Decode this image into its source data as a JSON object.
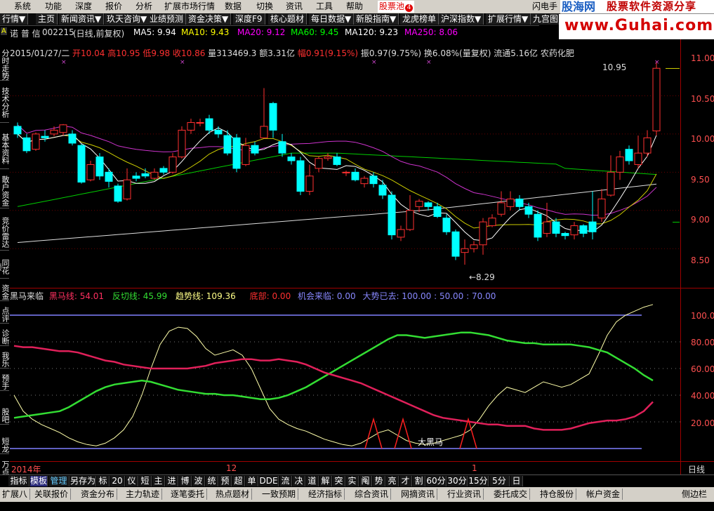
{
  "menu": {
    "items": [
      "系统",
      "功能",
      "深度",
      "报价",
      "分析",
      "扩展市场行情",
      "数据",
      "切换",
      "资讯",
      "工具",
      "帮助"
    ],
    "stockpool": "股票池",
    "stockpool_badge": "4",
    "flash": "闪电手",
    "brand1": "股海网",
    "brand2": "股票软件资源分享"
  },
  "site": {
    "url": "www.Guhai.com.cn"
  },
  "toolbar": {
    "items": [
      "行情▼",
      "主页",
      "新闻资讯▼",
      "玖天咨询▼",
      "业绩预测",
      "资金决策▼",
      "深度F9",
      "核心题材",
      "每日数据▼",
      "新股指南▼",
      "龙虎榜单",
      "沪深指数▼",
      "扩展行情▼",
      "九宫图"
    ]
  },
  "leftnav": {
    "corner": "A",
    "items": [
      "分时走势",
      "技术分析",
      "基本资料",
      "散户资金",
      "竞价雷达",
      "同花顺",
      "资金",
      "点评",
      "诊断",
      "我乐",
      "预手",
      "股吧",
      "短龙",
      "万点"
    ]
  },
  "stock": {
    "name": "诺 普 信",
    "code": "002215",
    "mode": "(日线,前复权)"
  },
  "ma": [
    {
      "label": "MA5: 9.94",
      "color": "#ffffff"
    },
    {
      "label": "MA10: 9.43",
      "color": "#ffff00"
    },
    {
      "label": "MA20: 9.12",
      "color": "#ff00ff"
    },
    {
      "label": "MA60: 9.45",
      "color": "#00ff00"
    },
    {
      "label": "MA120: 9.23",
      "color": "#ffffff"
    },
    {
      "label": "MA250: 8.06",
      "color": "#ff00ff"
    }
  ],
  "info": {
    "date": "2015/01/27/二",
    "open": "开10.04",
    "high": "高10.95",
    "low": "低9.98",
    "close": "收10.86",
    "vol": "量313469.3",
    "amt": "额3.31亿",
    "chg": "幅0.91(9.15%)",
    "amp": "振0.97(9.75%)",
    "turn": "换6.08%(量复权)",
    "float": "流通5.16亿",
    "sector": "农药化肥"
  },
  "price_axis": [
    "11.00",
    "10.50",
    "10.00",
    "9.50",
    "9.00",
    "8.50"
  ],
  "annotations": {
    "high": "10.95",
    "low": "←8.29"
  },
  "indicator": {
    "name": "黑马来临",
    "hm": "黑马线: 54.01",
    "fq": "反切线: 45.99",
    "trend": "趋势线: 109.36",
    "bottom": "底部: 0.00",
    "chance": "机会来临: 0.00",
    "trendgone": "大势已去: 100.00 : 50.00 : 70.00",
    "label": "大黑马"
  },
  "ind_axis": [
    "100.0",
    "80.00",
    "60.00",
    "40.00",
    "20.00"
  ],
  "dates": {
    "year": "2014年",
    "m12": "12",
    "m1": "1",
    "period": "日线"
  },
  "bottombar": [
    "指标",
    "模板",
    "管理",
    "另存为",
    "标",
    "20",
    "仪",
    "短",
    "主",
    "进",
    "博",
    "波",
    "统",
    "预",
    "超",
    "单",
    "DDE",
    "流",
    "决",
    "道",
    "解",
    "突",
    "实",
    "阄",
    "势",
    "亮",
    "才",
    "割",
    "60分",
    "30分",
    "15分",
    "5分",
    "日"
  ],
  "statusbar": [
    "扩展八",
    "关联报价",
    "资金分布",
    "主力轨迹",
    "逐笔委托",
    "热点题材",
    "一致预期",
    "经济指标",
    "综合资讯",
    "网摘资讯",
    "行业资讯",
    "委托成交",
    "持仓股份",
    "帐户资金"
  ],
  "statusbar_right": "侧边栏<",
  "chart_data": {
    "type": "candlestick",
    "title": "诺 普 信 002215(日线,前复权)",
    "price_ylim": [
      8.3,
      11.0
    ],
    "candles": [
      [
        10.1,
        10.0,
        10.15,
        9.95
      ],
      [
        9.95,
        9.78,
        10.0,
        9.75
      ],
      [
        9.8,
        10.0,
        10.02,
        9.78
      ],
      [
        9.97,
        9.95,
        10.05,
        9.9
      ],
      [
        10.0,
        10.05,
        10.1,
        9.97
      ],
      [
        10.02,
        10.12,
        10.13,
        9.98
      ],
      [
        10.0,
        9.88,
        10.05,
        9.85
      ],
      [
        9.85,
        9.37,
        9.87,
        9.35
      ],
      [
        9.4,
        9.6,
        9.65,
        9.38
      ],
      [
        9.7,
        9.45,
        9.75,
        9.4
      ],
      [
        9.5,
        9.38,
        9.55,
        9.3
      ],
      [
        9.32,
        9.12,
        9.35,
        9.1
      ],
      [
        9.15,
        9.4,
        9.55,
        9.13
      ],
      [
        9.45,
        9.42,
        9.5,
        9.38
      ],
      [
        9.48,
        9.45,
        9.55,
        9.42
      ],
      [
        9.42,
        9.5,
        9.55,
        9.4
      ],
      [
        9.55,
        9.5,
        9.58,
        9.47
      ],
      [
        9.5,
        9.7,
        9.75,
        9.48
      ],
      [
        9.7,
        10.05,
        10.1,
        9.68
      ],
      [
        10.05,
        10.15,
        10.2,
        10.0
      ],
      [
        10.15,
        10.15,
        10.2,
        10.1
      ],
      [
        10.2,
        10.05,
        10.25,
        10.0
      ],
      [
        10.05,
        10.0,
        10.1,
        9.95
      ],
      [
        9.98,
        9.75,
        10.05,
        9.72
      ],
      [
        9.95,
        9.55,
        10.0,
        9.5
      ],
      [
        9.6,
        9.85,
        9.95,
        9.58
      ],
      [
        9.85,
        9.75,
        9.9,
        9.72
      ],
      [
        9.95,
        10.1,
        10.6,
        9.95
      ],
      [
        10.4,
        10.05,
        10.42,
        9.95
      ],
      [
        9.9,
        9.75,
        10.0,
        9.7
      ],
      [
        9.7,
        9.65,
        9.75,
        9.6
      ],
      [
        9.65,
        9.25,
        9.7,
        9.2
      ],
      [
        9.25,
        9.45,
        9.6,
        9.2
      ],
      [
        9.55,
        9.68,
        9.7,
        9.5
      ],
      [
        9.68,
        9.7,
        9.75,
        9.65
      ],
      [
        9.7,
        9.6,
        9.75,
        9.58
      ],
      [
        9.5,
        9.5,
        9.52,
        9.45
      ],
      [
        9.5,
        9.4,
        9.55,
        9.38
      ],
      [
        9.35,
        9.42,
        9.45,
        9.3
      ],
      [
        9.45,
        9.35,
        9.5,
        9.3
      ],
      [
        9.33,
        9.2,
        9.4,
        9.15
      ],
      [
        9.2,
        8.68,
        9.25,
        8.62
      ],
      [
        8.65,
        8.75,
        8.8,
        8.6
      ],
      [
        8.75,
        9.0,
        9.2,
        8.73
      ],
      [
        9.05,
        9.12,
        9.15,
        8.98
      ],
      [
        9.1,
        9.05,
        9.12,
        9.0
      ],
      [
        9.05,
        8.92,
        9.1,
        8.9
      ],
      [
        8.9,
        8.72,
        8.95,
        8.68
      ],
      [
        8.72,
        8.4,
        8.75,
        8.35
      ],
      [
        8.45,
        8.5,
        8.62,
        8.29
      ],
      [
        8.5,
        8.55,
        8.6,
        8.45
      ],
      [
        8.55,
        8.85,
        8.9,
        8.42
      ],
      [
        8.8,
        8.9,
        8.95,
        8.78
      ],
      [
        8.95,
        9.1,
        9.25,
        8.92
      ],
      [
        9.05,
        9.15,
        9.25,
        9.0
      ],
      [
        9.15,
        9.05,
        9.2,
        9.0
      ],
      [
        9.05,
        8.95,
        9.1,
        8.9
      ],
      [
        8.95,
        8.65,
        9.0,
        8.6
      ],
      [
        8.7,
        8.85,
        9.1,
        8.65
      ],
      [
        8.85,
        8.7,
        8.9,
        8.65
      ],
      [
        8.7,
        8.67,
        8.72,
        8.62
      ],
      [
        8.68,
        8.8,
        8.85,
        8.62
      ],
      [
        8.8,
        8.7,
        8.82,
        8.65
      ],
      [
        8.85,
        8.72,
        9.25,
        8.62
      ],
      [
        8.9,
        9.15,
        9.28,
        8.85
      ],
      [
        9.2,
        9.5,
        9.72,
        9.18
      ],
      [
        9.5,
        9.7,
        9.78,
        9.4
      ],
      [
        9.8,
        9.65,
        9.85,
        9.6
      ],
      [
        9.6,
        9.75,
        9.98,
        9.55
      ],
      [
        9.75,
        9.95,
        10.05,
        9.7
      ],
      [
        10.04,
        10.86,
        10.95,
        9.98
      ]
    ],
    "ma_ylim": [
      8.3,
      11.0
    ],
    "ind_ylim": [
      0,
      115
    ],
    "grid": true
  }
}
